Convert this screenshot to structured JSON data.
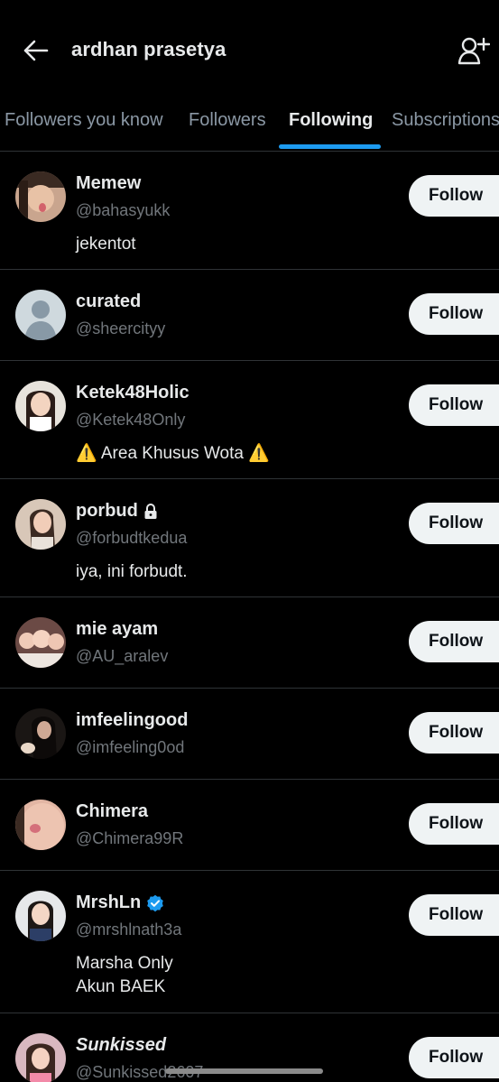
{
  "header": {
    "title": "ardhan prasetya",
    "back_icon": "arrow-left-icon",
    "add_user_icon": "person-plus-icon"
  },
  "tabs": [
    {
      "label": "Followers you know",
      "active": false
    },
    {
      "label": "Followers",
      "active": false
    },
    {
      "label": "Following",
      "active": true
    },
    {
      "label": "Subscriptions",
      "active": false
    }
  ],
  "colors": {
    "background": "#000000",
    "accent": "#1d9bf0",
    "verified": "#1d9bf0",
    "divider": "#2f3336",
    "button_bg": "#eff3f4"
  },
  "users": [
    {
      "name": "Memew",
      "handle": "@bahasyukk",
      "bio": "jekentot",
      "button": "Follow"
    },
    {
      "name": "curated",
      "handle": "@sheercityy",
      "bio": "",
      "button": "Follow"
    },
    {
      "name": "Ketek48Holic",
      "handle": "@Ketek48Only",
      "bio": "⚠️ Area Khusus Wota ⚠️",
      "button": "Follow"
    },
    {
      "name": "porbud",
      "handle": "@forbudtkedua",
      "bio": "iya, ini forbudt.",
      "button": "Follow",
      "protected": true
    },
    {
      "name": "mie ayam",
      "handle": "@AU_aralev",
      "bio": "",
      "button": "Follow"
    },
    {
      "name": "imfeelingood",
      "handle": "@imfeeling0od",
      "bio": "",
      "button": "Follow"
    },
    {
      "name": "Chimera",
      "handle": "@Chimera99R",
      "bio": "",
      "button": "Follow"
    },
    {
      "name": "MrshLn",
      "handle": "@mrshlnath3a",
      "bio_line1": "Marsha Only",
      "bio_line2": "Akun BAEK",
      "button": "Follow",
      "verified": true
    },
    {
      "name": "Sunkissed",
      "handle": "@Sunkissed2607",
      "bio": "",
      "button": "Follow"
    }
  ]
}
